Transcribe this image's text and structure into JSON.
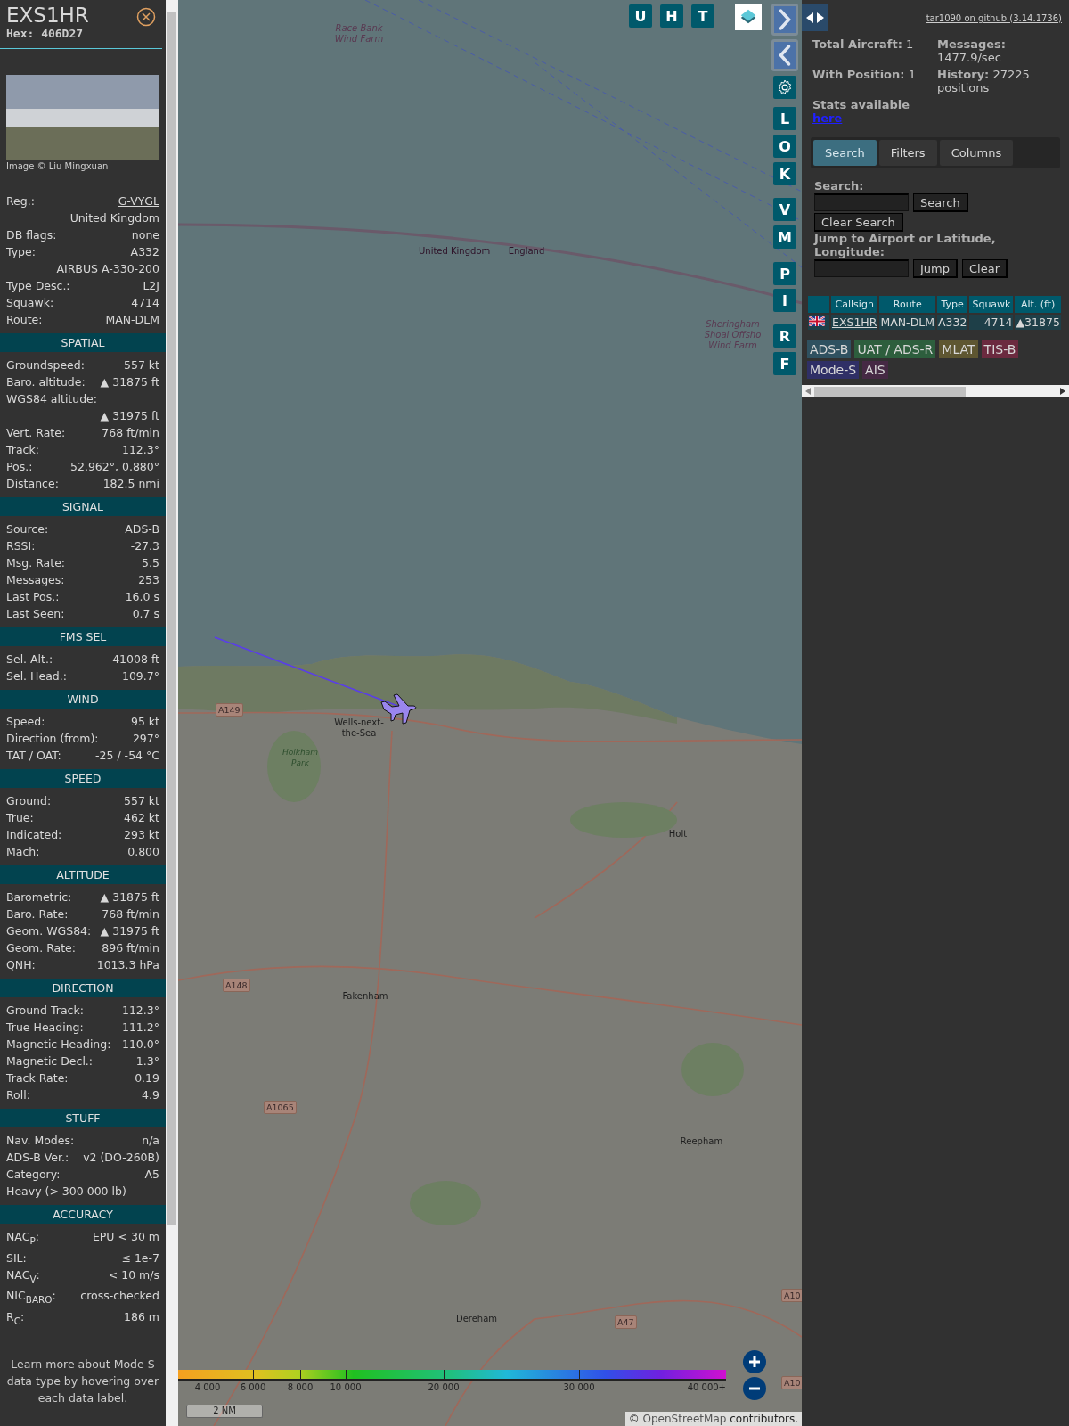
{
  "sidebar": {
    "title": "EXS1HR",
    "hex": "Hex: 406D27",
    "photo_credit": "Image © Liu Mingxuan",
    "rows": [
      {
        "kind": "link",
        "label": "Reg.:",
        "value": "G-VYGL"
      },
      {
        "kind": "value",
        "value": "United Kingdom"
      },
      {
        "kind": "pair",
        "label": "DB flags:",
        "value": "none"
      },
      {
        "kind": "pair",
        "label": "Type:",
        "value": "A332"
      },
      {
        "kind": "value",
        "value": "AIRBUS A-330-200"
      },
      {
        "kind": "pair",
        "label": "Type Desc.:",
        "value": "L2J"
      },
      {
        "kind": "pair",
        "label": "Squawk:",
        "value": "4714"
      },
      {
        "kind": "pair",
        "label": "Route:",
        "value": "MAN-DLM"
      }
    ],
    "sections": [
      {
        "heading": "SPATIAL",
        "rows": [
          {
            "kind": "pair",
            "label": "Groundspeed:",
            "value": "557 kt"
          },
          {
            "kind": "pair",
            "label": "Baro. altitude:",
            "value": "▲ 31875 ft"
          },
          {
            "kind": "label",
            "label": "WGS84 altitude:"
          },
          {
            "kind": "value",
            "value": "▲ 31975 ft"
          },
          {
            "kind": "pair",
            "label": "Vert. Rate:",
            "value": "768 ft/min"
          },
          {
            "kind": "pair",
            "label": "Track:",
            "value": "112.3°"
          },
          {
            "kind": "pair",
            "label": "Pos.:",
            "value": "52.962°, 0.880°"
          },
          {
            "kind": "pair",
            "label": "Distance:",
            "value": "182.5 nmi"
          }
        ]
      },
      {
        "heading": "SIGNAL",
        "rows": [
          {
            "kind": "pair",
            "label": "Source:",
            "value": "ADS-B"
          },
          {
            "kind": "pair",
            "label": "RSSI:",
            "value": "-27.3"
          },
          {
            "kind": "pair",
            "label": "Msg. Rate:",
            "value": "5.5"
          },
          {
            "kind": "pair",
            "label": "Messages:",
            "value": "253"
          },
          {
            "kind": "pair",
            "label": "Last Pos.:",
            "value": "16.0 s"
          },
          {
            "kind": "pair",
            "label": "Last Seen:",
            "value": "0.7 s"
          }
        ]
      },
      {
        "heading": "FMS SEL",
        "rows": [
          {
            "kind": "pair",
            "label": "Sel. Alt.:",
            "value": "41008 ft"
          },
          {
            "kind": "pair",
            "label": "Sel. Head.:",
            "value": "109.7°"
          }
        ]
      },
      {
        "heading": "WIND",
        "rows": [
          {
            "kind": "pair",
            "label": "Speed:",
            "value": "95 kt"
          },
          {
            "kind": "pair",
            "label": "Direction (from):",
            "value": "297°"
          },
          {
            "kind": "pair",
            "label": "TAT / OAT:",
            "value": "-25 / -54 °C"
          }
        ]
      },
      {
        "heading": "SPEED",
        "rows": [
          {
            "kind": "pair",
            "label": "Ground:",
            "value": "557 kt"
          },
          {
            "kind": "pair",
            "label": "True:",
            "value": "462 kt"
          },
          {
            "kind": "pair",
            "label": "Indicated:",
            "value": "293 kt"
          },
          {
            "kind": "pair",
            "label": "Mach:",
            "value": "0.800"
          }
        ]
      },
      {
        "heading": "ALTITUDE",
        "rows": [
          {
            "kind": "pair",
            "label": "Barometric:",
            "value": "▲ 31875 ft"
          },
          {
            "kind": "pair",
            "label": "Baro. Rate:",
            "value": "768 ft/min"
          },
          {
            "kind": "pair",
            "label": "Geom. WGS84:",
            "value": "▲ 31975 ft"
          },
          {
            "kind": "pair",
            "label": "Geom. Rate:",
            "value": "896 ft/min"
          },
          {
            "kind": "pair",
            "label": "QNH:",
            "value": "1013.3 hPa"
          }
        ]
      },
      {
        "heading": "DIRECTION",
        "rows": [
          {
            "kind": "pair",
            "label": "Ground Track:",
            "value": "112.3°"
          },
          {
            "kind": "pair",
            "label": "True Heading:",
            "value": "111.2°"
          },
          {
            "kind": "pair",
            "label": "Magnetic Heading:",
            "value": "110.0°"
          },
          {
            "kind": "pair",
            "label": "Magnetic Decl.:",
            "value": "1.3°"
          },
          {
            "kind": "pair",
            "label": "Track Rate:",
            "value": "0.19"
          },
          {
            "kind": "pair",
            "label": "Roll:",
            "value": "4.9"
          }
        ]
      },
      {
        "heading": "STUFF",
        "rows": [
          {
            "kind": "pair",
            "label": "Nav. Modes:",
            "value": "n/a"
          },
          {
            "kind": "pair",
            "label": "ADS-B Ver.:",
            "value": "v2 (DO-260B)"
          },
          {
            "kind": "pair",
            "label": "Category:",
            "value": "A5"
          },
          {
            "kind": "label",
            "label": "Heavy (> 300 000 lb)"
          }
        ]
      },
      {
        "heading": "ACCURACY",
        "rows": [
          {
            "kind": "pair",
            "label": "NAC$_{P}$:",
            "value": "EPU < 30 m"
          },
          {
            "kind": "pair",
            "label": "SIL:",
            "value": "≤ 1e-7"
          },
          {
            "kind": "pair",
            "label": "NAC$_{V}$:",
            "value": "< 10 m/s"
          },
          {
            "kind": "pair",
            "label": "NIC$_{BARO}$:",
            "value": "cross-checked"
          },
          {
            "kind": "pair",
            "label": "R$_{C}$:",
            "value": "186 m"
          }
        ]
      }
    ],
    "footer": "Learn more about Mode S data type by hovering over each data label."
  },
  "map": {
    "top_buttons": [
      "U",
      "H",
      "T"
    ],
    "side_buttons": [
      "L",
      "O",
      "K",
      "V",
      "M",
      "P",
      "I",
      "R",
      "F"
    ],
    "places": [
      {
        "kind": "sea",
        "text": "Race Bank Wind Farm"
      },
      {
        "kind": "border",
        "text": "United Kingdom"
      },
      {
        "kind": "border",
        "text": "England"
      },
      {
        "kind": "sea",
        "text": "Sheringham Shoal Offsho Wind Farm"
      },
      {
        "kind": "town",
        "text": "Wells-next-the-Sea"
      },
      {
        "kind": "park",
        "text": "Holkham Park"
      },
      {
        "kind": "town",
        "text": "Holt"
      },
      {
        "kind": "town",
        "text": "Fakenham"
      },
      {
        "kind": "town",
        "text": "Reepham"
      },
      {
        "kind": "town",
        "text": "Dereham"
      }
    ],
    "roads": [
      "A149",
      "A148",
      "A1065",
      "A47",
      "A10",
      "A10"
    ],
    "legend_ticks": [
      "4 000",
      "6 000",
      "8 000",
      "10 000",
      "20 000",
      "30 000",
      "40 000+"
    ],
    "scale": "2 NM",
    "attribution_prefix": "©",
    "attribution_link": "OpenStreetMap",
    "attribution_suffix": "contributors."
  },
  "panel": {
    "version_link": "tar1090 on github (3.14.1736)",
    "stats": [
      {
        "label": "Total Aircraft:",
        "value": "1"
      },
      {
        "label": "Messages:",
        "value": "1477.9/sec"
      },
      {
        "label": "With Position:",
        "value": "1"
      },
      {
        "label": "History:",
        "value": "27225 positions"
      }
    ],
    "stats_link_text": "Stats available",
    "stats_link": "here",
    "tabs": [
      {
        "label": "Search",
        "selected": true
      },
      {
        "label": "Filters",
        "selected": false
      },
      {
        "label": "Columns",
        "selected": false
      }
    ],
    "search_label": "Search:",
    "search_button": "Search",
    "clear_search_button": "Clear Search",
    "jump_label": "Jump to Airport or Latitude, Longitude:",
    "jump_button": "Jump",
    "clear_button": "Clear",
    "table": {
      "columns": [
        "Callsign",
        "Route",
        "Type",
        "Squawk",
        "Alt. (ft)"
      ],
      "rows": [
        {
          "callsign": "EXS1HR",
          "route": "MAN-DLM",
          "type": "A332",
          "squawk": "4714",
          "alt": "▲31875"
        }
      ]
    },
    "sources": [
      {
        "label": "ADS-B",
        "color": "#2f5160"
      },
      {
        "label": "UAT / ADS-R",
        "color": "#2d5e3d"
      },
      {
        "label": "MLAT",
        "color": "#5e5631"
      },
      {
        "label": "TIS-B",
        "color": "#6b2a3f"
      },
      {
        "label": "Mode-S",
        "color": "#2f2f66"
      },
      {
        "label": "AIS",
        "color": "#452944"
      }
    ]
  }
}
